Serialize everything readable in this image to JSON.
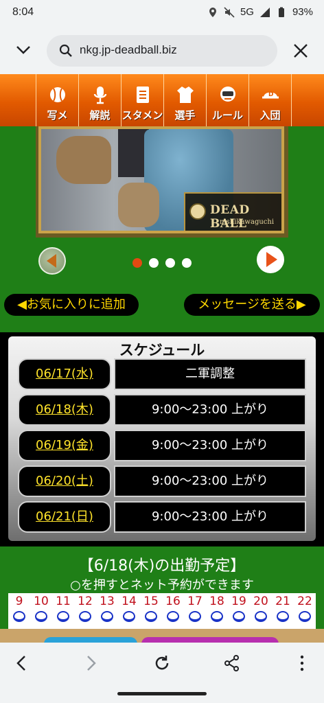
{
  "status": {
    "time": "8:04",
    "network": "5G",
    "battery": "93%"
  },
  "browser": {
    "url": "nkg.jp-deadball.biz"
  },
  "nav": {
    "items": [
      {
        "label": "写メ",
        "icon": "baseball-icon"
      },
      {
        "label": "解説",
        "icon": "microphone-icon"
      },
      {
        "label": "スタメン",
        "icon": "document-icon"
      },
      {
        "label": "選手",
        "icon": "jersey-icon"
      },
      {
        "label": "ルール",
        "icon": "umpire-icon"
      },
      {
        "label": "入団",
        "icon": "cap-icon"
      }
    ]
  },
  "hero": {
    "logo_title": "DEAD BALL",
    "logo_sub": "nishikawaguchi"
  },
  "carousel": {
    "slides": 4,
    "active": 1
  },
  "actions": {
    "favorite": "◀お気に入りに追加",
    "message": "メッセージを送る▶"
  },
  "schedule": {
    "title": "スケジュール",
    "rows": [
      {
        "date": "06/17(水)",
        "value": "二軍調整"
      },
      {
        "date": "06/18(木)",
        "value": "9:00〜23:00 上がり"
      },
      {
        "date": "06/19(金)",
        "value": "9:00〜23:00 上がり"
      },
      {
        "date": "06/20(土)",
        "value": "9:00〜23:00 上がり"
      },
      {
        "date": "06/21(日)",
        "value": "9:00〜23:00 上がり"
      }
    ]
  },
  "attendance": {
    "title": "【6/18(木)の出勤予定】",
    "subtitle": "○を押すとネット予約ができます",
    "hours": [
      "9",
      "10",
      "11",
      "12",
      "13",
      "14",
      "15",
      "16",
      "17",
      "18",
      "19",
      "20",
      "21",
      "22"
    ]
  },
  "colors": {
    "nav_orange": "#e25a00",
    "bg_green": "#1f7f17",
    "date_yellow": "#ffe32a",
    "hour_red": "#c0101c",
    "reserve_blue": "#1a33c7"
  }
}
